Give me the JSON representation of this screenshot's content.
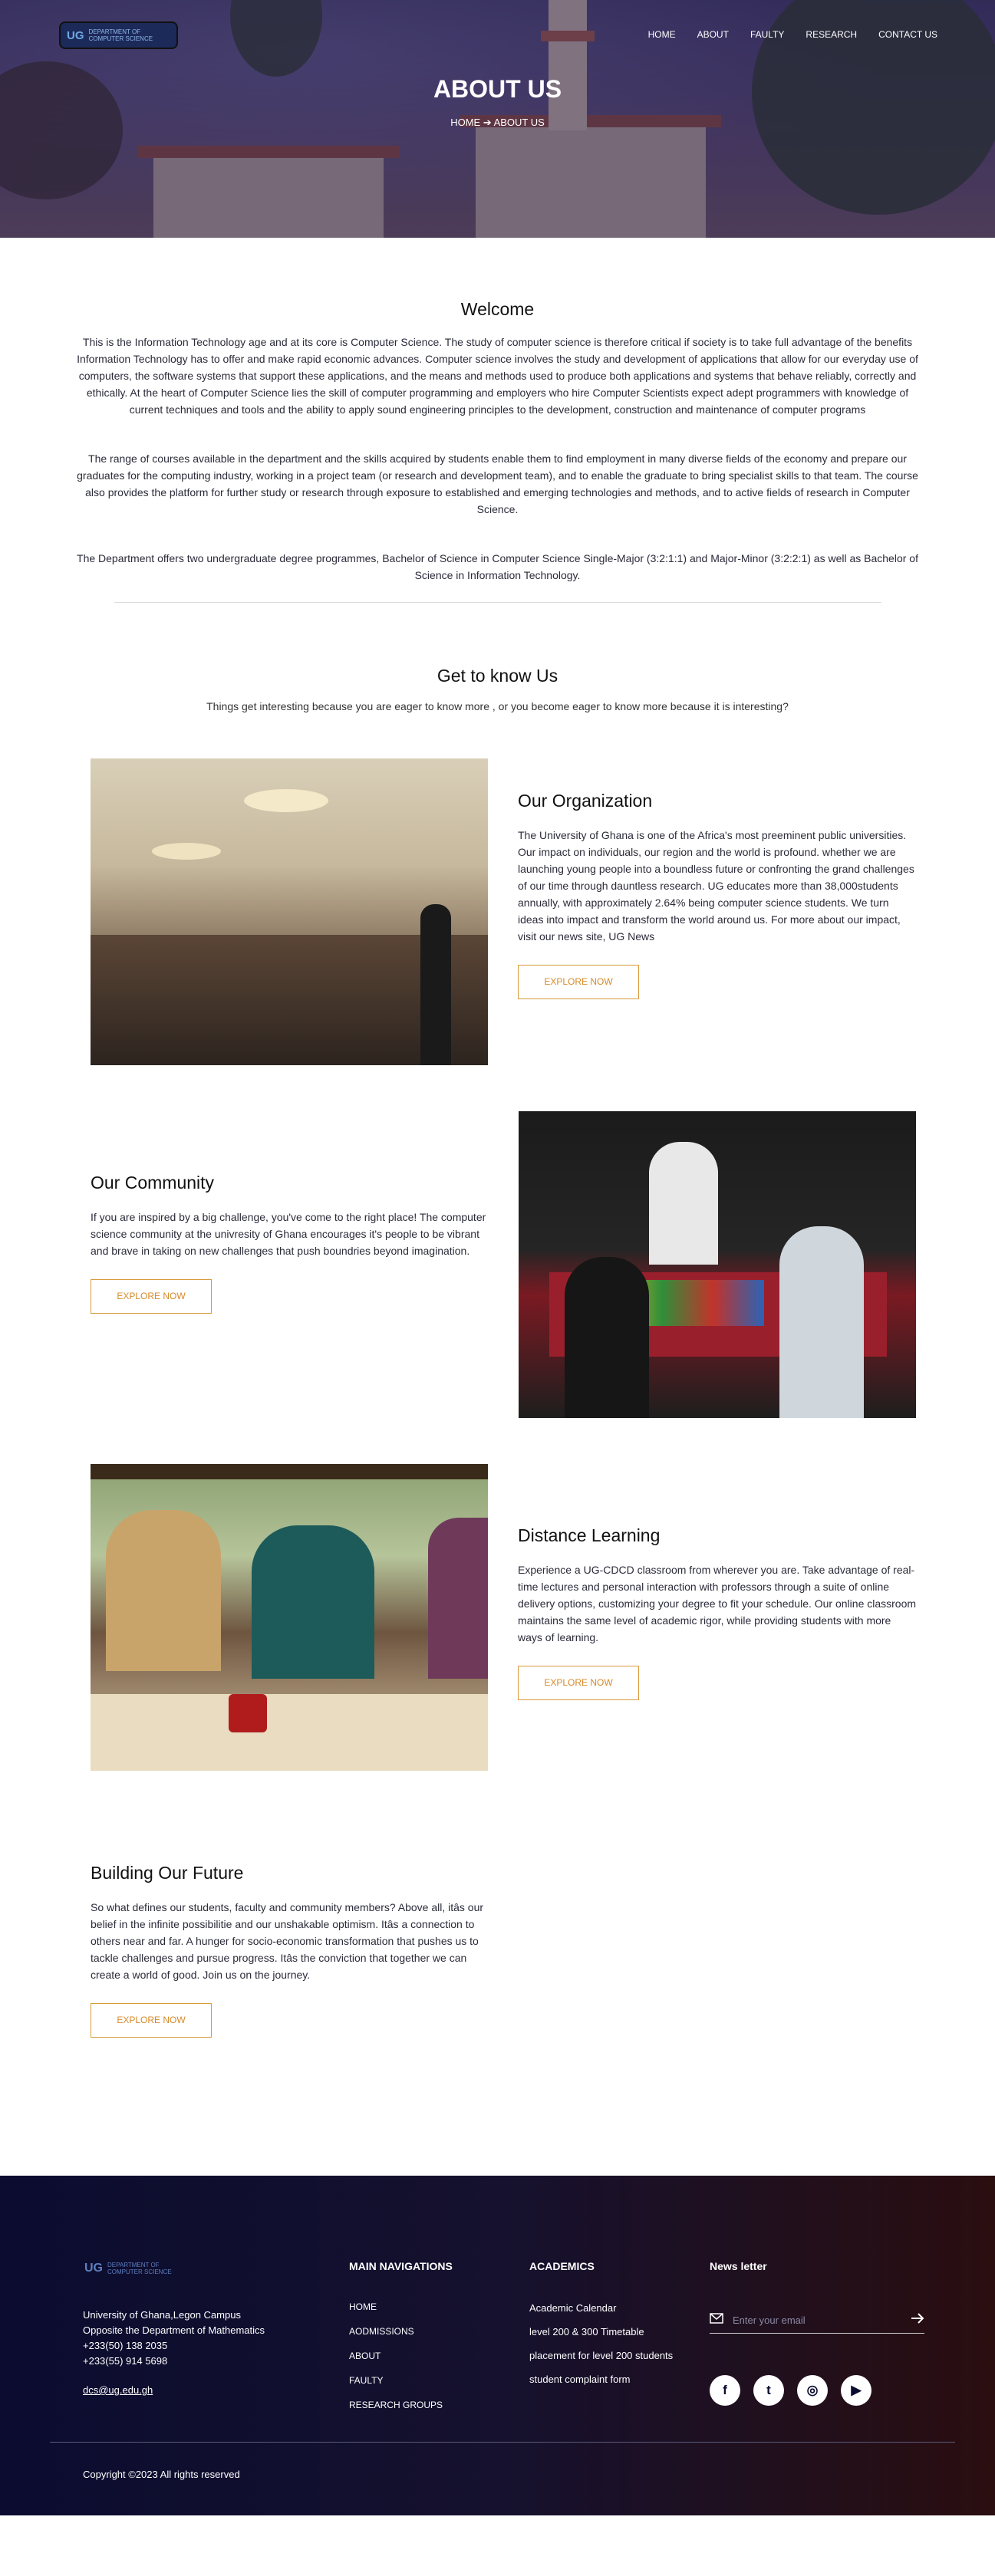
{
  "header": {
    "logo_mark": "UG",
    "logo_text_line1": "Department of",
    "logo_text_line2": "Computer Science",
    "nav": [
      "HOME",
      "ABOUT",
      "FAULTY",
      "RESEARCH",
      "CONTACT US"
    ],
    "title": "ABOUT US",
    "breadcrumb": "HOME ➔ ABOUT US"
  },
  "welcome": {
    "title": "Welcome",
    "paragraphs": [
      "This is the Information Technology age and at its core is Computer Science. The study of computer science is therefore critical if society is to take full advantage of the benefits Information Technology has to offer and make rapid economic advances. Computer science involves the study and development of applications that allow for our everyday use of computers, the software systems that support these applications, and the means and methods used to produce both applications and systems that behave reliably, correctly and ethically. At the heart of Computer Science lies the skill of computer programming and employers who hire Computer Scientists expect adept programmers with knowledge of current techniques and tools and the ability to apply sound engineering principles to the development, construction and maintenance of computer programs",
      "The range of courses available in the department and the skills acquired by students enable them to find employment in many diverse fields of the economy and prepare our graduates for the computing industry, working in a project team (or research and development team), and to enable the graduate to bring specialist skills to that team. The course also provides the platform for further study or research through exposure to established and emerging technologies and methods, and to active fields of research in Computer Science.",
      "The Department offers two undergraduate degree programmes, Bachelor of Science in Computer Science Single-Major (3:2:1:1) and Major-Minor (3:2:2:1) as well as Bachelor of Science in Information Technology."
    ]
  },
  "know": {
    "title": "Get to know Us",
    "subtitle": "Things get interesting because you are eager to know more , or you become eager to know more because it is interesting?"
  },
  "features": [
    {
      "title": "Our Organization",
      "text": "The University of Ghana is one of the Africa's most preeminent public universities. Our impact on individuals, our region and the world is profound. whether we are launching young people into a boundless future or confronting the grand challenges of our time through dauntless research. UG educates more than 38,000students annually, with approximately 2.64% being computer science students. We turn ideas into impact and transform the world around us. For more about our impact, visit our news site, UG News",
      "button": "EXPLORE NOW"
    },
    {
      "title": "Our Community",
      "text": "If you are inspired by a big challenge, you've come to the right place! The computer science community at the univresity of Ghana encourages it's people to be vibrant and brave in taking on new challenges that push boundries beyond imagination.",
      "button": "EXPLORE NOW"
    },
    {
      "title": "Distance Learning",
      "text": "Experience a UG-CDCD classroom from wherever you are. Take advantage of real-time lectures and personal interaction with professors through a suite of online delivery options, customizing your degree to fit your schedule. Our online classroom maintains the same level of academic rigor, while providing students with more ways of learning.",
      "button": "EXPLORE NOW"
    },
    {
      "title": "Building Our Future",
      "text": "So what defines our students, faculty and community members? Above all, itâs our belief in the infinite possibilitie and our unshakable optimism. Itâs a connection to others near and far. A hunger for socio-economic transformation that pushes us to tackle challenges and pursue progress. Itâs the conviction that together we can create a world of good. Join us on the journey.",
      "button": "EXPLORE NOW"
    }
  ],
  "footer": {
    "logo_mark": "UG",
    "logo_text_line1": "Department of",
    "logo_text_line2": "Computer Science",
    "address": [
      "University of Ghana,Legon Campus",
      "Opposite the Department of Mathematics",
      "+233(50) 138 2035",
      "+233(55) 914 5698"
    ],
    "email": "dcs@ug.edu.gh",
    "main_nav_title": "MAIN NAVIGATIONS",
    "main_nav": [
      "HOME",
      "AODMISSIONS",
      "ABOUT",
      "FAULTY",
      "RESEARCH GROUPS"
    ],
    "academics_title": "ACADEMICS",
    "academics": [
      "Academic Calendar",
      "level 200 & 300 Timetable",
      "placement for level 200 students",
      "student complaint form"
    ],
    "newsletter_title": "News letter",
    "newsletter_placeholder": "Enter your email",
    "socials": [
      "facebook-icon",
      "twitter-icon",
      "instagram-icon",
      "youtube-icon"
    ],
    "copyright": "Copyright ©2023 All rights reserved"
  },
  "colors": {
    "accent": "#d58a2a",
    "footer_dark": "#0b0c30",
    "footer_warm": "#2a0e10"
  }
}
